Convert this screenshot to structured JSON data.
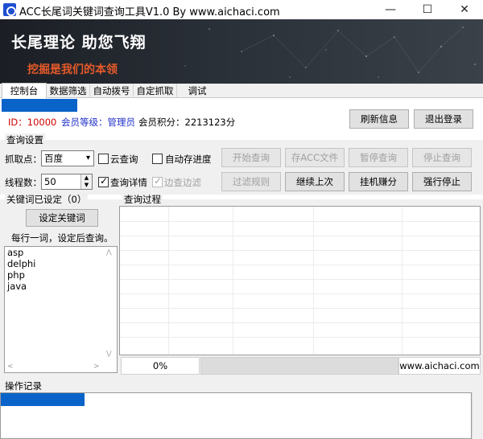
{
  "window": {
    "title": "ACC长尾词关键词查询工具V1.0  By  www.aichaci.com",
    "minimize": "—",
    "maximize": "☐",
    "close": "✕"
  },
  "banner": {
    "slogan": "长尾理论 助您飞翔",
    "subslogan": "挖掘是我们的本领"
  },
  "tabs": [
    "控制台",
    "数据筛选",
    "自动拨号",
    "自定抓取",
    "调试"
  ],
  "account": {
    "id_label": "ID：10000",
    "level_label": "会员等级：管理员",
    "points_label": "会员积分：2213123分",
    "refresh_button": "刷新信息",
    "logout_button": "退出登录"
  },
  "query_settings": {
    "group_title": "查询设置",
    "grab_label": "抓取点：",
    "grab_value": "百度",
    "cloud_query": "云查询",
    "auto_save": "自动存进度",
    "threads_label": "线程数：",
    "threads_value": "50",
    "query_detail": "查询详情",
    "side_filter": "边查边滤",
    "buttons": {
      "start": "开始查询",
      "save_acc": "存ACC文件",
      "pause": "暂停查询",
      "stop": "停止查询",
      "filter_rules": "过滤规则",
      "continue": "继续上次",
      "earn": "挂机赚分",
      "force_stop": "强行停止"
    }
  },
  "keywords": {
    "group_title": "关键词已设定（0）",
    "set_button": "设定关键词",
    "hint": "每行一词，设定后查询。",
    "items": [
      "asp",
      "delphi",
      "php",
      "java"
    ]
  },
  "process": {
    "group_title": "查询过程"
  },
  "status": {
    "percent": "0%",
    "progress": 0,
    "site": "www.aichaci.com"
  },
  "log": {
    "group_title": "操作记录"
  },
  "colors": {
    "progress_blue": "#0a63c8",
    "id_red": "#d00000",
    "level_blue": "#2030c8",
    "subslogan_orange": "#e55a2a"
  }
}
